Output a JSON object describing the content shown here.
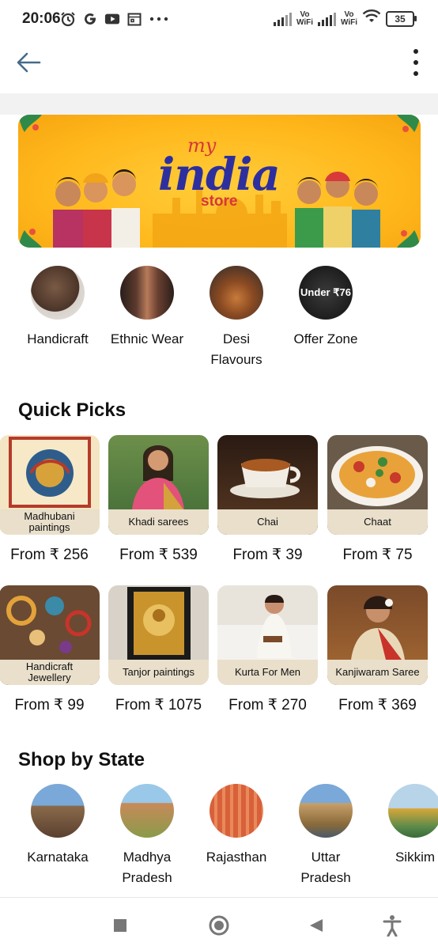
{
  "status_bar": {
    "time": "20:06",
    "left_icons": [
      "alarm-icon",
      "g-icon",
      "youtube-icon",
      "calendar-icon",
      "more-dots-icon"
    ],
    "vo_wifi_1": "Vo\nWiFi",
    "vo_wifi_2": "Vo\nWiFi",
    "battery": "35"
  },
  "banner": {
    "title_small": "my",
    "title_main": "india",
    "title_sub": "store"
  },
  "categories": [
    {
      "label": "Handicraft"
    },
    {
      "label": "Ethnic Wear"
    },
    {
      "label": "Desi\nFlavours"
    },
    {
      "label": "Offer Zone",
      "badge": "Under ₹76"
    }
  ],
  "quick_picks": {
    "title": "Quick Picks",
    "items": [
      {
        "caption": "Madhubani\npaintings",
        "price": "From ₹ 256"
      },
      {
        "caption": "Khadi sarees",
        "price": "From ₹ 539"
      },
      {
        "caption": "Chai",
        "price": "From ₹ 39"
      },
      {
        "caption": "Chaat",
        "price": "From ₹ 75"
      },
      {
        "caption": "Handicraft\nJewellery",
        "price": "From ₹ 99"
      },
      {
        "caption": "Tanjor paintings",
        "price": "From ₹ 1075"
      },
      {
        "caption": "Kurta For Men",
        "price": "From ₹ 270"
      },
      {
        "caption": "Kanjiwaram Saree",
        "price": "From ₹ 369"
      }
    ]
  },
  "shop_by_state": {
    "title": "Shop by State",
    "items": [
      {
        "label": "Karnataka"
      },
      {
        "label": "Madhya\nPradesh"
      },
      {
        "label": "Rajasthan"
      },
      {
        "label": "Uttar\nPradesh"
      },
      {
        "label": "Sikkim"
      }
    ]
  },
  "colors": {
    "banner_bg": "#ffb81c",
    "caption_bg": "#e9dfcb",
    "india_text": "#2e2f9e",
    "accent_red": "#d6363a"
  }
}
